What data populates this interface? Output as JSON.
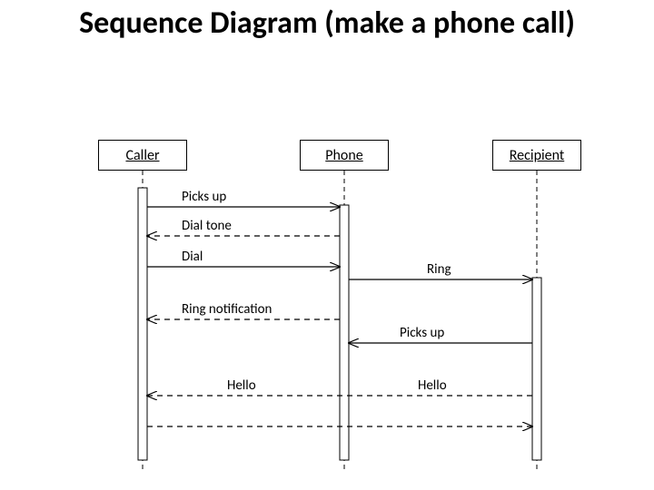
{
  "title": "Sequence Diagram (make a phone call)",
  "actors": {
    "caller": "Caller",
    "phone": "Phone",
    "recipient": "Recipient"
  },
  "messages": {
    "m1": "Picks up",
    "m2": "Dial tone",
    "m3": "Dial",
    "m4": "Ring",
    "m5": "Ring notification",
    "m6": "Picks up",
    "m7": "Hello",
    "m8": "Hello"
  },
  "chart_data": {
    "type": "sequence-diagram",
    "participants": [
      "Caller",
      "Phone",
      "Recipient"
    ],
    "messages": [
      {
        "from": "Caller",
        "to": "Phone",
        "label": "Picks up",
        "style": "solid"
      },
      {
        "from": "Phone",
        "to": "Caller",
        "label": "Dial tone",
        "style": "dashed"
      },
      {
        "from": "Caller",
        "to": "Phone",
        "label": "Dial",
        "style": "solid"
      },
      {
        "from": "Phone",
        "to": "Recipient",
        "label": "Ring",
        "style": "solid"
      },
      {
        "from": "Phone",
        "to": "Caller",
        "label": "Ring notification",
        "style": "dashed"
      },
      {
        "from": "Recipient",
        "to": "Phone",
        "label": "Picks up",
        "style": "solid"
      },
      {
        "from": "Recipient",
        "to": "Caller",
        "label": "Hello",
        "style": "dashed"
      },
      {
        "from": "Caller",
        "to": "Recipient",
        "label": "Hello",
        "style": "dashed"
      }
    ]
  }
}
